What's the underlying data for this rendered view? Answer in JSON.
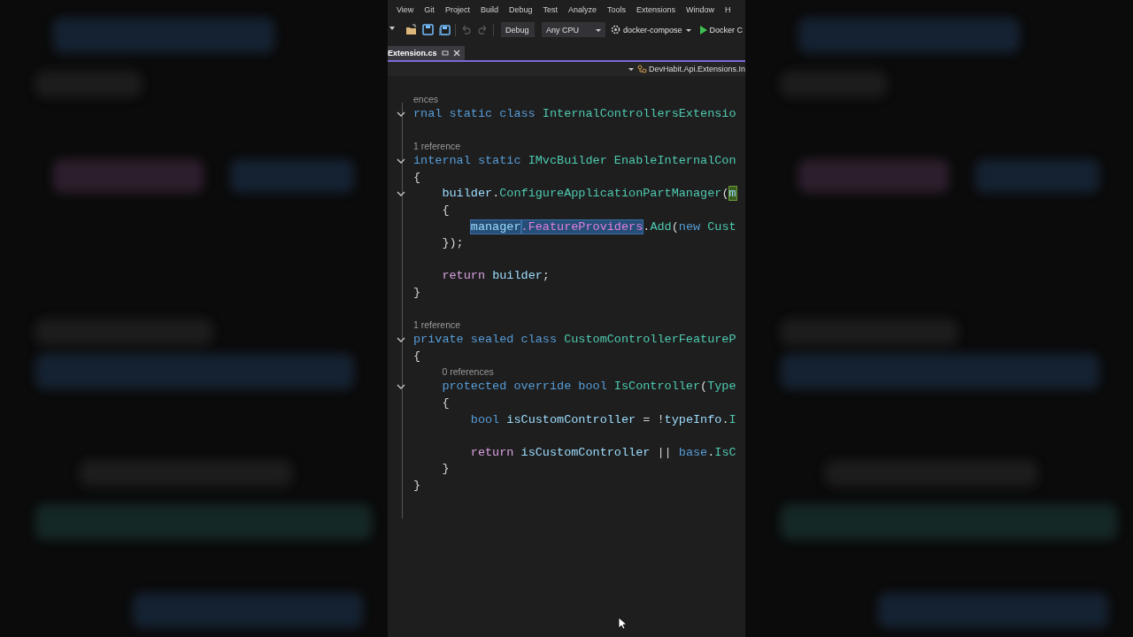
{
  "menu": [
    "View",
    "Git",
    "Project",
    "Build",
    "Debug",
    "Test",
    "Analyze",
    "Tools",
    "Extensions",
    "Window",
    "H"
  ],
  "toolbar": [
    {
      "kind": "caret",
      "disabled": false
    },
    {
      "kind": "open",
      "disabled": false
    },
    {
      "kind": "save",
      "disabled": false
    },
    {
      "kind": "save-all",
      "disabled": false
    },
    {
      "kind": "undo",
      "disabled": true
    },
    {
      "kind": "redo",
      "disabled": true
    },
    {
      "kind": "dropdown",
      "label": "Debug"
    },
    {
      "kind": "dropdown",
      "label": "Any CPU"
    },
    {
      "kind": "target",
      "label": "docker-compose"
    },
    {
      "kind": "run",
      "label": "Docker C"
    }
  ],
  "tabs": [
    {
      "label": "Extension.cs",
      "selected": true
    }
  ],
  "navbar": {
    "label": "DevHabit.Api.Extensions.In"
  },
  "lines": [
    {
      "kind": "lens",
      "text": "ences"
    },
    {
      "kind": "code",
      "fold": true,
      "tokens": [
        {
          "kind": "kw",
          "text": "rnal static class "
        },
        {
          "kind": "name",
          "text": "InternalControllersExtensio"
        }
      ]
    },
    {
      "kind": "blank"
    },
    {
      "kind": "lens",
      "text": "1 reference"
    },
    {
      "kind": "code",
      "fold": true,
      "tokens": [
        {
          "kind": "kw",
          "text": "internal static "
        },
        {
          "kind": "name",
          "text": "IMvcBuilder EnableInternalCon"
        }
      ]
    },
    {
      "kind": "code",
      "fold": false,
      "tokens": [
        {
          "kind": "punct",
          "text": "{"
        }
      ]
    },
    {
      "kind": "code",
      "fold": true,
      "tokens": [
        {
          "kind": "ident",
          "text": "    builder"
        },
        {
          "kind": "punct",
          "text": "."
        },
        {
          "kind": "name",
          "text": "ConfigureApplicationPartManager"
        },
        {
          "kind": "punct",
          "text": "("
        },
        {
          "kind": "ident",
          "text": "m",
          "matched": true
        }
      ]
    },
    {
      "kind": "code",
      "fold": false,
      "tokens": [
        {
          "kind": "punct",
          "text": "    {"
        }
      ]
    },
    {
      "kind": "code",
      "fold": false,
      "tokens": [
        {
          "kind": "ident",
          "text": "        manager",
          "selected": true
        },
        {
          "kind": "prop",
          "text": ".FeatureProviders",
          "selected": true
        },
        {
          "kind": "punct",
          "text": "."
        },
        {
          "kind": "name",
          "text": "Add"
        },
        {
          "kind": "punct",
          "text": "("
        },
        {
          "kind": "kw",
          "text": "new "
        },
        {
          "kind": "name",
          "text": "Cust"
        }
      ]
    },
    {
      "kind": "code",
      "fold": false,
      "tokens": [
        {
          "kind": "punct",
          "text": "    });"
        }
      ]
    },
    {
      "kind": "blank"
    },
    {
      "kind": "code",
      "fold": false,
      "tokens": [
        {
          "kind": "ctrl",
          "text": "    return "
        },
        {
          "kind": "ident",
          "text": "builder"
        },
        {
          "kind": "punct",
          "text": ";"
        }
      ]
    },
    {
      "kind": "code",
      "fold": false,
      "tokens": [
        {
          "kind": "punct",
          "text": "}"
        }
      ]
    },
    {
      "kind": "blank"
    },
    {
      "kind": "lens",
      "text": "1 reference"
    },
    {
      "kind": "code",
      "fold": true,
      "tokens": [
        {
          "kind": "kw",
          "text": "private sealed class "
        },
        {
          "kind": "name",
          "text": "CustomControllerFeatureP"
        }
      ]
    },
    {
      "kind": "code",
      "fold": false,
      "tokens": [
        {
          "kind": "punct",
          "text": "{"
        }
      ]
    },
    {
      "kind": "lens",
      "text": "0 references",
      "indented": true
    },
    {
      "kind": "code",
      "fold": true,
      "tokens": [
        {
          "kind": "kw",
          "text": "    protected override bool "
        },
        {
          "kind": "name",
          "text": "IsController"
        },
        {
          "kind": "punct",
          "text": "("
        },
        {
          "kind": "name",
          "text": "Type"
        }
      ]
    },
    {
      "kind": "code",
      "fold": false,
      "tokens": [
        {
          "kind": "punct",
          "text": "    {"
        }
      ]
    },
    {
      "kind": "code",
      "fold": false,
      "tokens": [
        {
          "kind": "kw",
          "text": "        bool "
        },
        {
          "kind": "ident",
          "text": "isCustomController"
        },
        {
          "kind": "punct",
          "text": " = !"
        },
        {
          "kind": "ident",
          "text": "typeInfo"
        },
        {
          "kind": "punct",
          "text": "."
        },
        {
          "kind": "name",
          "text": "I"
        }
      ]
    },
    {
      "kind": "blank"
    },
    {
      "kind": "code",
      "fold": false,
      "tokens": [
        {
          "kind": "ctrl",
          "text": "        return "
        },
        {
          "kind": "ident",
          "text": "isCustomController"
        },
        {
          "kind": "punct",
          "text": " || "
        },
        {
          "kind": "kw",
          "text": "base"
        },
        {
          "kind": "punct",
          "text": "."
        },
        {
          "kind": "name",
          "text": "IsC"
        }
      ]
    },
    {
      "kind": "code",
      "fold": false,
      "tokens": [
        {
          "kind": "punct",
          "text": "    }"
        }
      ]
    },
    {
      "kind": "code",
      "fold": false,
      "tokens": [
        {
          "kind": "punct",
          "text": "}"
        }
      ]
    }
  ]
}
